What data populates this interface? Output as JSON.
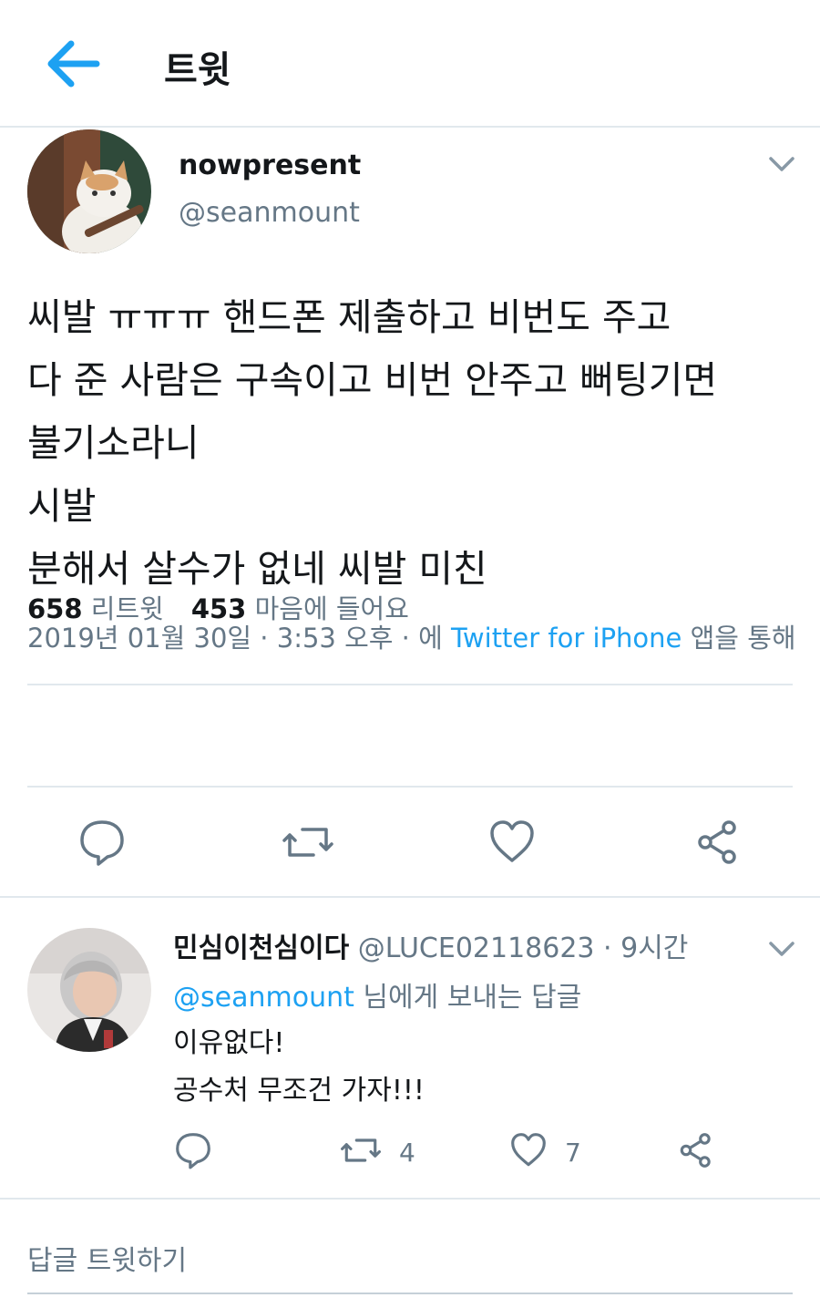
{
  "header": {
    "title": "트윗"
  },
  "tweet": {
    "display_name": "nowpresent",
    "handle": "@seanmount",
    "text": "씨발 ㅠㅠㅠ 핸드폰 제출하고 비번도 주고\n다 준 사람은 구속이고 비번 안주고 뻐팅기면\n불기소라니\n시발\n분해서 살수가 없네 씨발 미친",
    "meta_date": "2019년 01월 30일 · 3:53 오후 · 에 ",
    "meta_source": "Twitter for iPhone",
    "meta_suffix": " 앱을 통해",
    "retweet_count": "658",
    "retweet_label": " 리트윗",
    "like_count": "453",
    "like_label": " 마음에 들어요"
  },
  "reply": {
    "display_name": "민심이천심이다",
    "handle_time": " @LUCE02118623 · 9시간",
    "mention": "@seanmount",
    "reply_to_suffix": " 님에게 보내는 답글",
    "text": "이유없다!\n공수처 무조건 가자!!!",
    "retweet_count": "4",
    "like_count": "7"
  },
  "compose": {
    "placeholder": "답글 트윗하기"
  },
  "colors": {
    "accent": "#1da1f2",
    "secondary": "#657786",
    "divider": "#e1e8ed"
  }
}
